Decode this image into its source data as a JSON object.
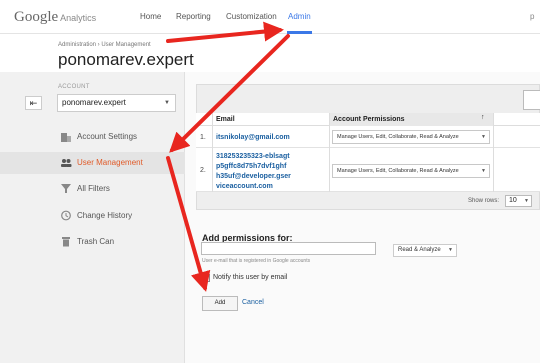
{
  "app": {
    "logo_google": "Google",
    "logo_analytics": "Analytics",
    "nav": [
      {
        "label": "Home"
      },
      {
        "label": "Reporting"
      },
      {
        "label": "Customization"
      },
      {
        "label": "Admin"
      }
    ],
    "user_initial": "p"
  },
  "header": {
    "breadcrumb": "Administration  ›  User Management",
    "title": "ponomarev.expert"
  },
  "sidebar": {
    "account_label": "ACCOUNT",
    "back_symbol": "⇤",
    "account_value": "ponomarev.expert",
    "items": [
      {
        "label": "Account Settings",
        "icon": "building-icon"
      },
      {
        "label": "User Management",
        "icon": "users-icon"
      },
      {
        "label": "All Filters",
        "icon": "filter-icon"
      },
      {
        "label": "Change History",
        "icon": "history-icon"
      },
      {
        "label": "Trash Can",
        "icon": "trash-icon"
      }
    ]
  },
  "table": {
    "col_email": "Email",
    "col_permissions": "Account Permissions",
    "rows": [
      {
        "num": "1.",
        "email": "itsnikolay@gmail.com",
        "permissions": "Manage Users, Edit, Collaborate, Read & Analyze"
      },
      {
        "num": "2.",
        "email": "318253235323-eblsagtp5gffc8d75h7dvf1ghfrh35uf@developer.gserviceaccount.com",
        "email_lines": [
          "318253235323-eblsagt",
          "p5gffc8d75h7dvf1ghf",
          "h35uf@developer.gser",
          "viceaccount.com"
        ],
        "permissions": "Manage Users, Edit, Collaborate, Read & Analyze"
      }
    ],
    "show_rows_label": "Show rows:",
    "show_rows_value": "10"
  },
  "add_permissions": {
    "title": "Add permissions for:",
    "input_value": "",
    "hint": "User e-mail that is registered in Google accounts",
    "permission_value": "Read & Analyze",
    "notify_label": "Notify this user by email",
    "add_button": "Add",
    "cancel_link": "Cancel"
  },
  "colors": {
    "accent_blue": "#3b78e7",
    "active_orange": "#e05a28",
    "annotation_red": "#e8261f"
  }
}
